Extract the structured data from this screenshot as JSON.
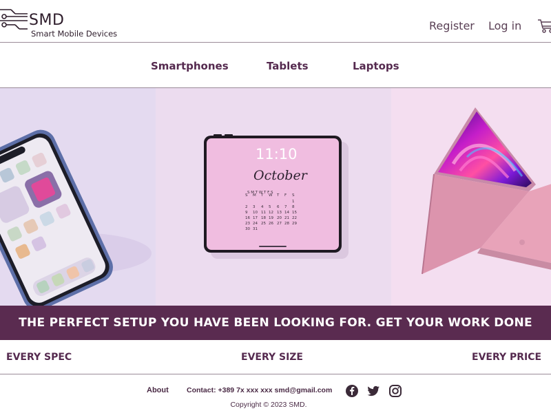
{
  "brand": {
    "name": "SMD",
    "tagline": "Smart Mobile Devices"
  },
  "top_nav": {
    "register": "Register",
    "login": "Log in",
    "cart_icon": "cart-icon"
  },
  "categories": [
    {
      "label": "Smartphones"
    },
    {
      "label": "Tablets"
    },
    {
      "label": "Laptops"
    }
  ],
  "hero": {
    "tablet_time": "11:10",
    "tablet_month": "October",
    "images": [
      "smartphone-photo",
      "tablet-photo",
      "laptop-photo"
    ]
  },
  "banner": {
    "text": "THE PERFECT SETUP YOU HAVE BEEN LOOKING FOR. GET YOUR WORK DONE"
  },
  "features": [
    "EVERY SPEC",
    "EVERY SIZE",
    "EVERY PRICE"
  ],
  "footer": {
    "about": "About",
    "contact": "Contact: +389 7x xxx xxx  smd@gmail.com",
    "social": [
      "facebook-icon",
      "twitter-icon",
      "instagram-icon"
    ],
    "copyright": "Copyright © 2023 SMD."
  },
  "colors": {
    "accent": "#5a2b50",
    "text": "#552a4f",
    "panel_left": "#e4daf0",
    "panel_mid": "#ecdcef",
    "panel_right": "#f4def0"
  }
}
